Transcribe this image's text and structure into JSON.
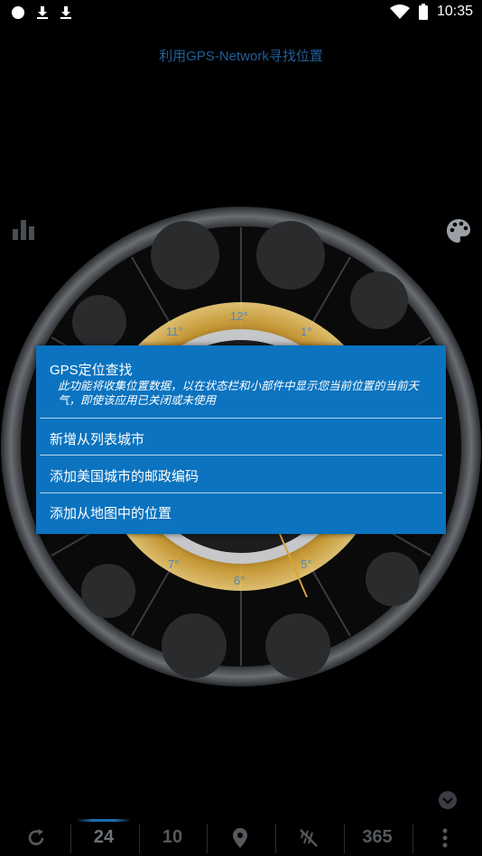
{
  "status": {
    "time": "10:35",
    "icons": [
      "circle-icon",
      "download-icon",
      "download-icon",
      "wifi-icon",
      "battery-icon"
    ]
  },
  "header": {
    "subtitle": "利用GPS-Network寻找位置"
  },
  "side": {
    "left_icon": "bar-chart-icon",
    "right_icon": "palette-icon"
  },
  "clock": {
    "labels": {
      "h12": "12°",
      "h1": "1°",
      "h11": "11°",
      "h5": "5°",
      "h6": "6°",
      "h7": "7°"
    }
  },
  "dialog": {
    "title": "GPS定位查找",
    "description": "此功能将收集位置数据，以在状态栏和小部件中显示您当前位置的当前天气，即使该应用已关闭或未使用",
    "items": [
      "新增从列表城市",
      "添加美国城市的邮政编码",
      "添加从地图中的位置"
    ]
  },
  "bottom_bar": {
    "tabs": [
      {
        "icon": "refresh-icon"
      },
      {
        "label": "24"
      },
      {
        "label": "10"
      },
      {
        "icon": "location-pin-icon"
      },
      {
        "icon": "no-rain-icon"
      },
      {
        "label": "365"
      },
      {
        "icon": "more-vertical-icon"
      }
    ],
    "active_index": 1
  },
  "colors": {
    "dialog_bg": "#0b73bf",
    "subtitle": "#1f5f9a",
    "background": "#000000"
  }
}
